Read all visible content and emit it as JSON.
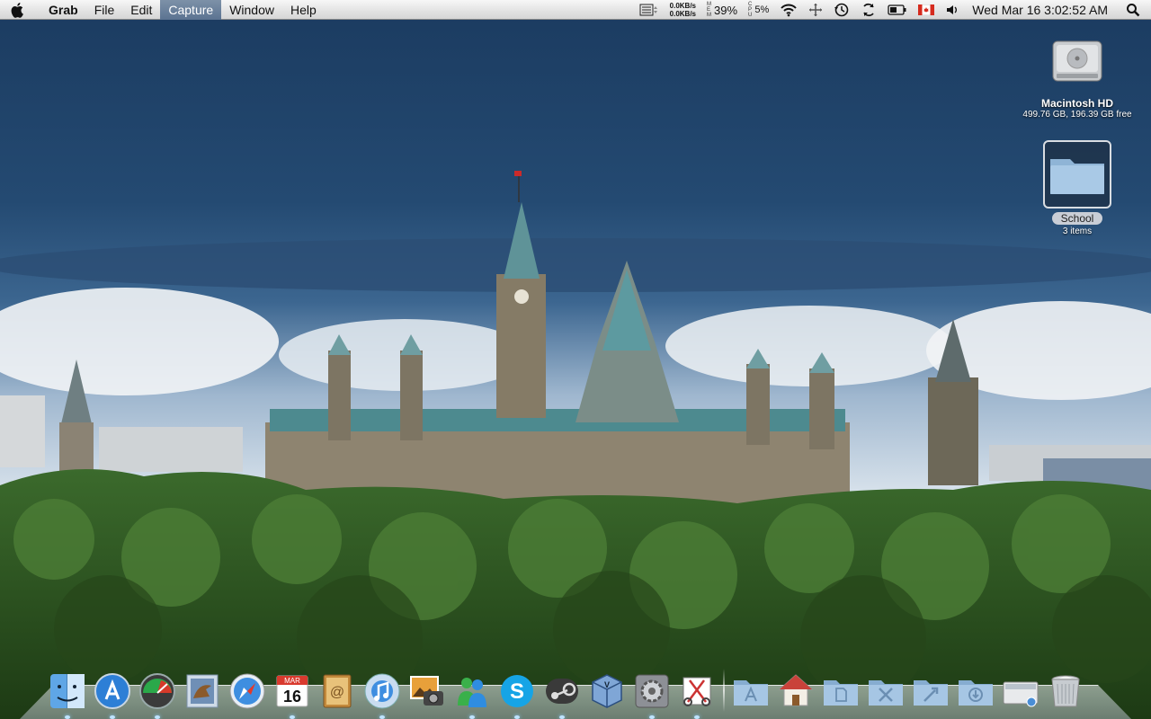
{
  "menubar": {
    "app_name": "Grab",
    "menus": [
      "File",
      "Edit",
      "Capture",
      "Window",
      "Help"
    ],
    "active_menu": "Capture",
    "network": {
      "up": "0.0KB/s",
      "down": "0.0KB/s"
    },
    "mem_label": "MEM",
    "mem_percent": "39%",
    "cpu_label": "CPU",
    "cpu_percent": "5%",
    "clock": "Wed Mar 16  3:02:52 AM"
  },
  "desktop": {
    "hard_drive": {
      "name": "Macintosh HD",
      "info": "499.76 GB, 196.39 GB free"
    },
    "folder": {
      "name": "School",
      "info": "3 items"
    }
  },
  "dock": {
    "apps": [
      "finder-icon",
      "app-store-icon",
      "activity-monitor-icon",
      "mail-icon",
      "safari-icon",
      "ical-icon",
      "address-book-icon",
      "itunes-icon",
      "iphoto-icon",
      "messenger-icon",
      "skype-icon",
      "steam-icon",
      "virtualbox-icon",
      "system-preferences-icon",
      "grab-icon"
    ],
    "calendar": {
      "month": "MAR",
      "day": "16"
    },
    "stacks": [
      "applications-stack-icon",
      "home-icon",
      "documents-stack-icon",
      "utilities-stack-icon",
      "developer-stack-icon",
      "downloads-stack-icon",
      "desktop-display-icon",
      "trash-icon"
    ]
  },
  "colors": {
    "menu_highlight": "#6a819d",
    "sky_dark": "#1f3e62",
    "forest": "#2f5a22"
  }
}
